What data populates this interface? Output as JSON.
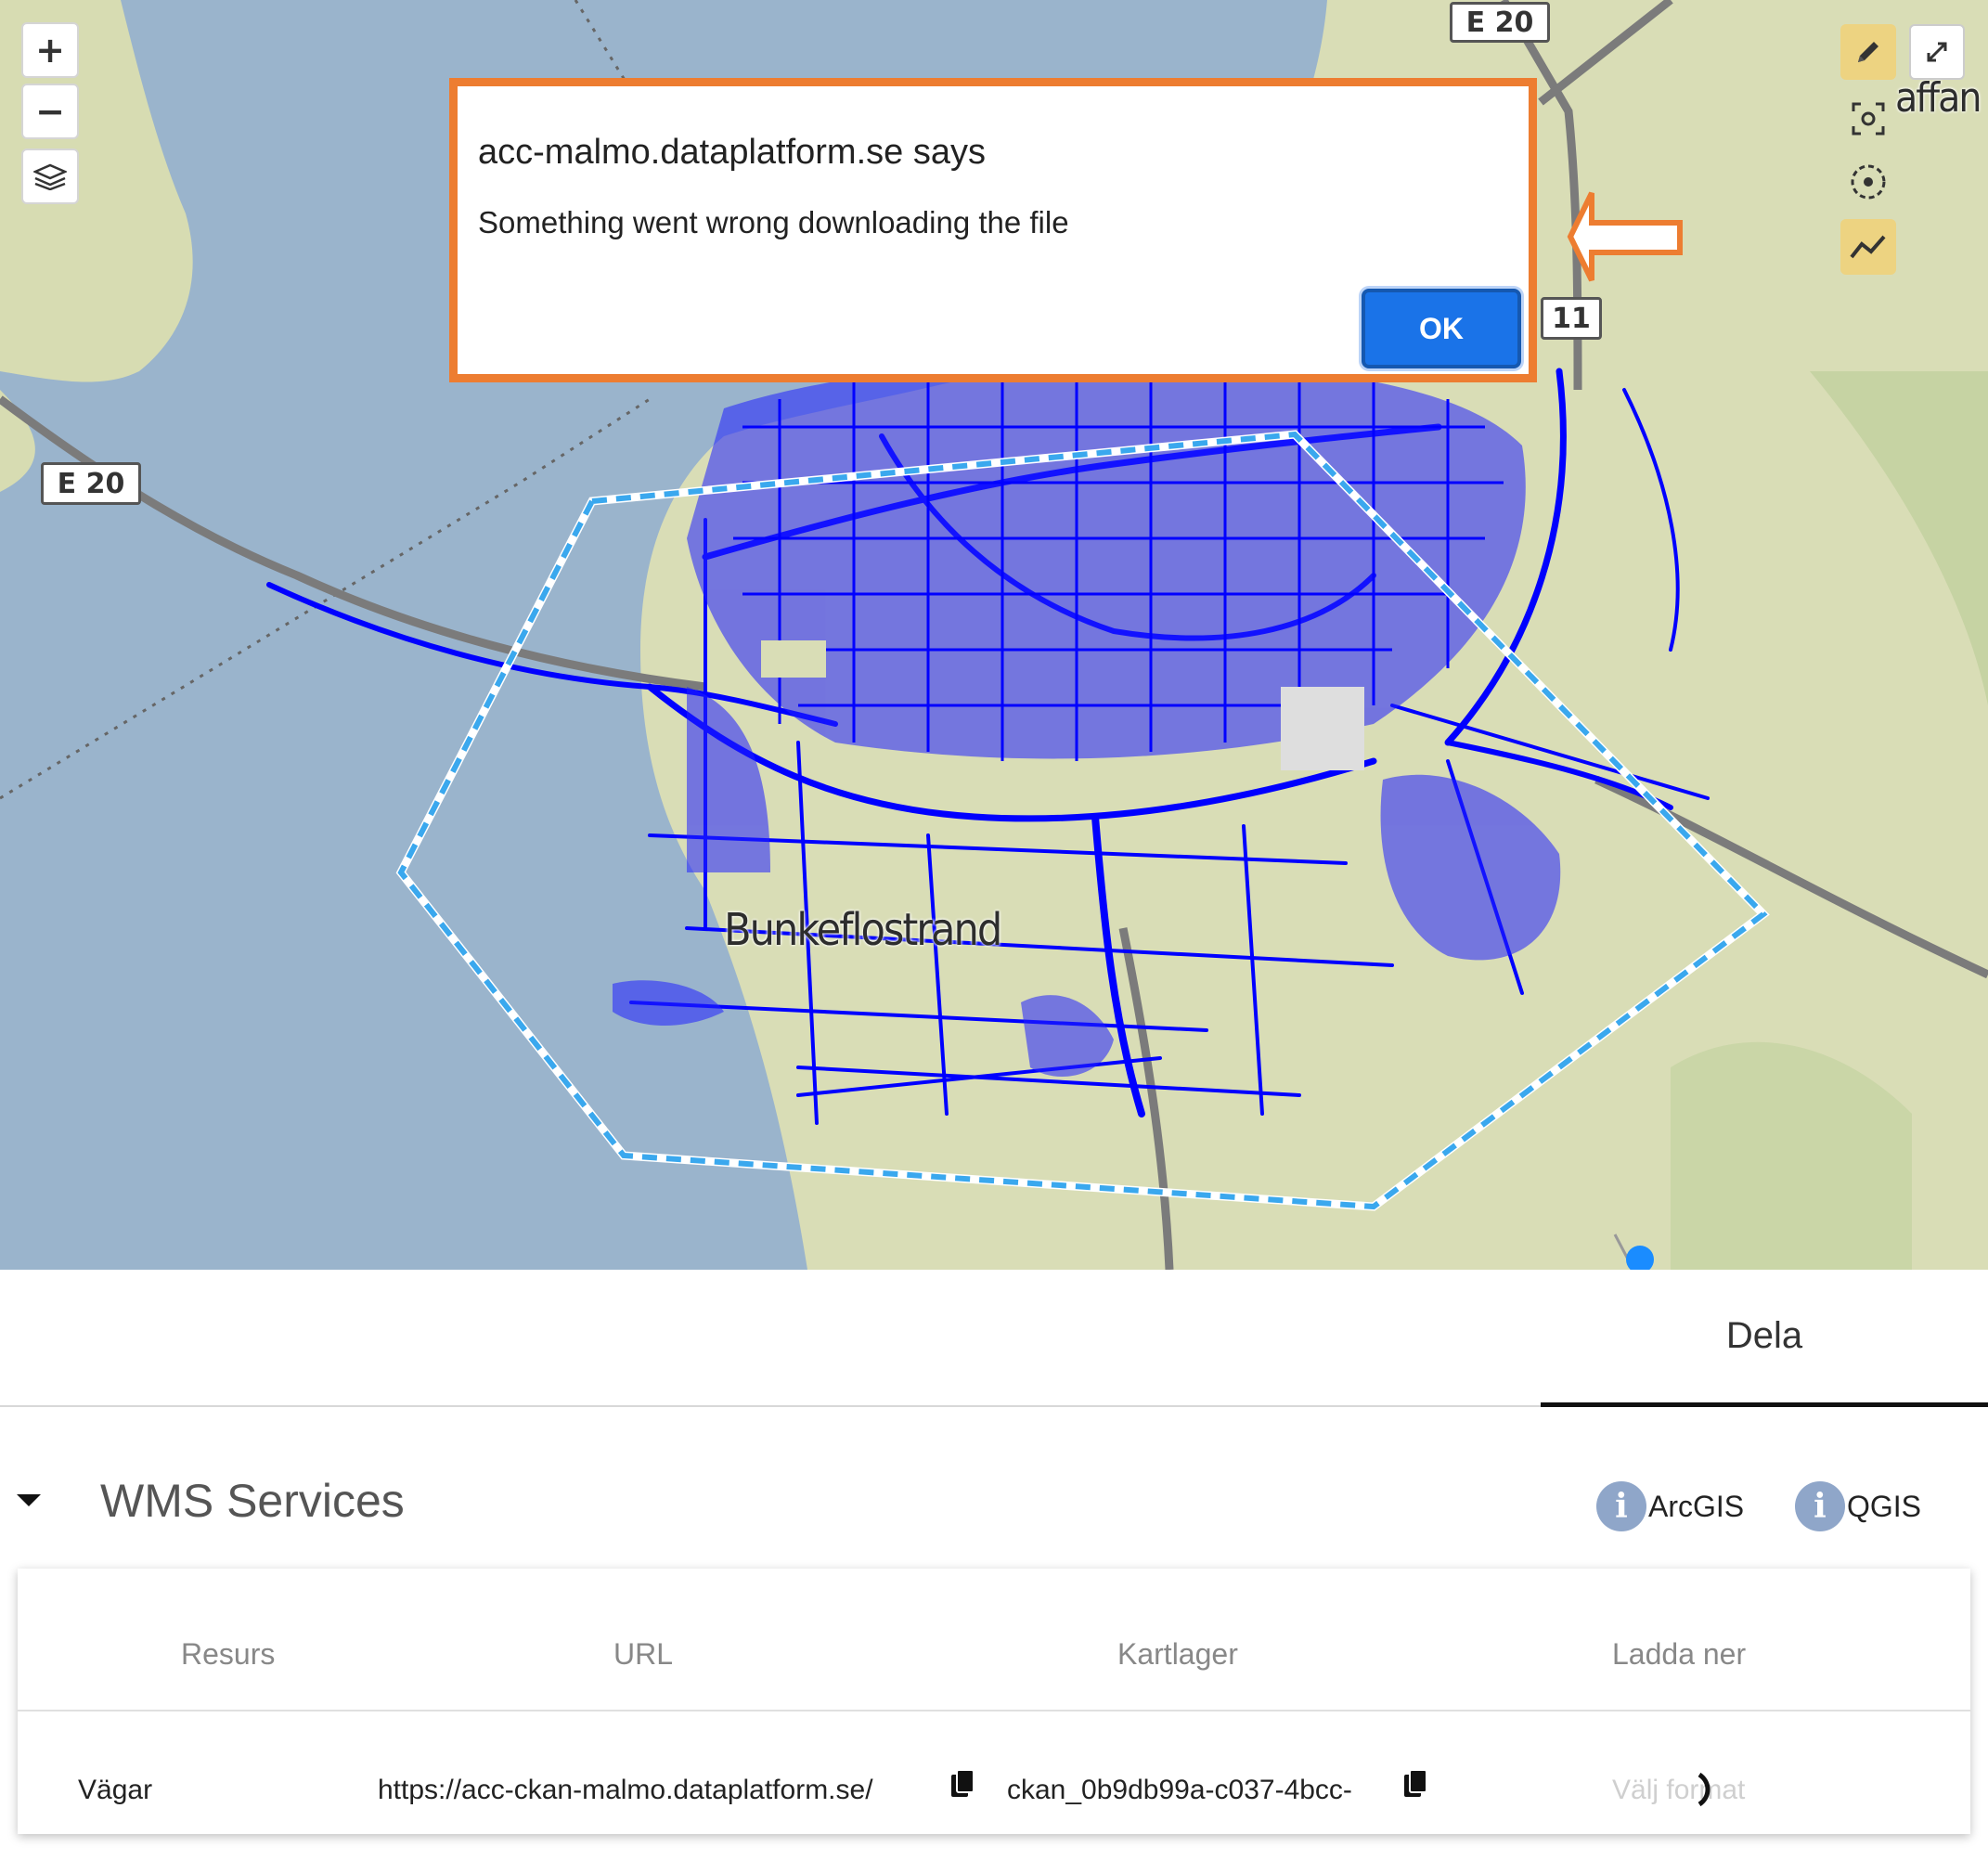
{
  "map": {
    "zoom_in_label": "+",
    "zoom_out_label": "−",
    "layers_icon": "layers-icon",
    "road_labels": [
      "E 20",
      "E 20",
      "11"
    ],
    "place_label": "Bunkeflostrand",
    "partial_label": "affan",
    "tools": [
      {
        "name": "draw-pencil-icon",
        "active": true
      },
      {
        "name": "fullscreen-icon",
        "active": false
      },
      {
        "name": "select-extent-icon",
        "active": false
      },
      {
        "name": "locate-icon",
        "active": false
      },
      {
        "name": "line-measure-icon",
        "active": true
      }
    ]
  },
  "dialog": {
    "title": "acc-malmo.dataplatform.se says",
    "message": "Something went wrong downloading the file",
    "ok_label": "OK"
  },
  "tabs": {
    "active": "Dela"
  },
  "wms": {
    "title": "WMS Services",
    "help_links": [
      "ArcGIS",
      "QGIS"
    ],
    "columns": [
      "Resurs",
      "URL",
      "Kartlager",
      "Ladda ner"
    ],
    "rows": [
      {
        "resurs": "Vägar",
        "url": "https://acc-ckan-malmo.dataplatform.se/",
        "kartlager": "ckan_0b9db99a-c037-4bcc-",
        "ladda_ner": "Välj format"
      }
    ]
  },
  "colors": {
    "dialog_border": "#ed7d31",
    "ok_button": "#1a73e8",
    "road_network": "#0000ff",
    "polygon": "#3aa8ee",
    "sea": "#9ab4cc",
    "land": "#d9ddb6"
  }
}
